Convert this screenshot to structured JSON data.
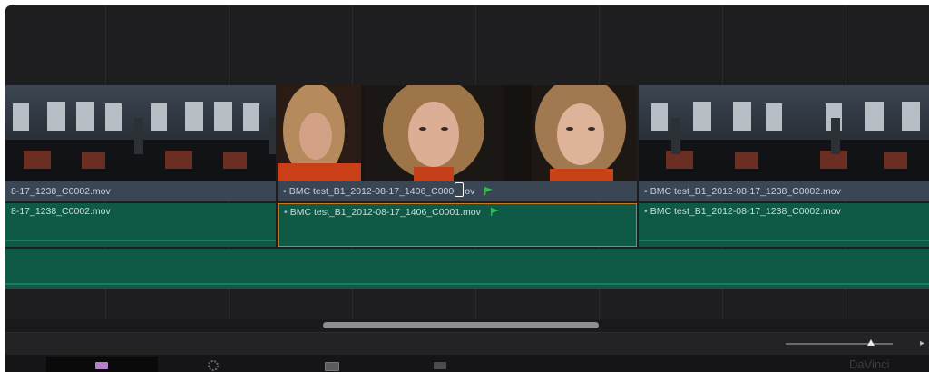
{
  "timeline": {
    "video_clips": [
      {
        "label": "8-17_1238_C0002.mov"
      },
      {
        "label_prefix": "BMC test_B1_2012-08-17_1406_C000",
        "label_suffix": "ov",
        "selected": true
      },
      {
        "label": "BMC test_B1_2012-08-17_1238_C0002.mov"
      }
    ],
    "audio_clips": [
      {
        "label": "8-17_1238_C0002.mov"
      },
      {
        "label": "BMC test_B1_2012-08-17_1406_C0001.mov",
        "selected": true
      },
      {
        "label": "BMC test_B1_2012-08-17_1238_C0002.mov"
      }
    ],
    "flag_color": "#2fbf4a",
    "selection_color": "#c87a1e",
    "audio_color": "#0f5a46"
  },
  "scrollbar": {
    "thumb_color": "#8e8e93"
  },
  "zoom_slider": {
    "level": 0.8
  },
  "page_bar": {
    "tabs": [
      {
        "icon": "media-page-icon",
        "active": true
      },
      {
        "icon": "color-wheel-icon",
        "active": false
      },
      {
        "icon": "edit-page-icon",
        "active": false
      },
      {
        "icon": "deliver-page-icon",
        "active": false
      }
    ],
    "brand": "DaVinci"
  }
}
